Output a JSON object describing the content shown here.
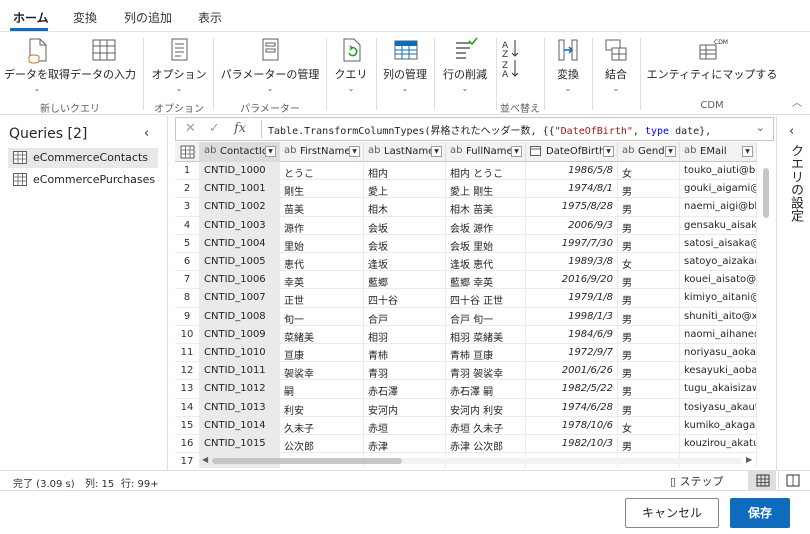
{
  "tabs": [
    {
      "label": "ホーム"
    },
    {
      "label": "変換"
    },
    {
      "label": "列の追加"
    },
    {
      "label": "表示"
    }
  ],
  "ribbon": {
    "get_data": "データを取得",
    "enter_data": "データの入力",
    "options": "オプション",
    "manage_params": "パラメーターの管理",
    "query": "クエリ",
    "manage_columns": "列の管理",
    "reduce_rows": "行の削減",
    "transform": "変換",
    "combine": "結合",
    "map_entity": "エンティティにマップする",
    "cdm_badge": "CDM",
    "groups": {
      "new_query": "新しいクエリ",
      "options": "オプション",
      "params": "パラメーター",
      "sort": "並べ替え",
      "cdm": "CDM"
    }
  },
  "queries": {
    "title": "Queries [2]",
    "items": [
      {
        "label": "eCommerceContacts"
      },
      {
        "label": "eCommercePurchases"
      }
    ]
  },
  "formula": {
    "fx": "fx",
    "part1": "Table.TransformColumnTypes(昇格されたヘッダー数, {{",
    "part2": "\"DateOfBirth\"",
    "part3": ", ",
    "part4": "type",
    "part5": " date},"
  },
  "grid": {
    "columns": [
      {
        "type": "ab",
        "name": "ContactId"
      },
      {
        "type": "ab",
        "name": "FirstName"
      },
      {
        "type": "ab",
        "name": "LastName"
      },
      {
        "type": "ab",
        "name": "FullName"
      },
      {
        "type": "date",
        "name": "DateOfBirth"
      },
      {
        "type": "ab",
        "name": "Gender"
      },
      {
        "type": "ab",
        "name": "EMail"
      }
    ],
    "rows": [
      {
        "n": "1",
        "c": [
          "CNTID_1000",
          "とうこ",
          "相内",
          "相内 とうこ",
          "1986/5/8",
          "女",
          "touko_aiuti@bb"
        ]
      },
      {
        "n": "2",
        "c": [
          "CNTID_1001",
          "剛生",
          "愛上",
          "愛上 剛生",
          "1974/8/1",
          "男",
          "gouki_aigami@"
        ]
      },
      {
        "n": "3",
        "c": [
          "CNTID_1002",
          "苗美",
          "相木",
          "相木 苗美",
          "1975/8/28",
          "男",
          "naemi_aigi@bb"
        ]
      },
      {
        "n": "4",
        "c": [
          "CNTID_1003",
          "源作",
          "会坂",
          "会坂 源作",
          "2006/9/3",
          "男",
          "gensaku_aisaka"
        ]
      },
      {
        "n": "5",
        "c": [
          "CNTID_1004",
          "里始",
          "会坂",
          "会坂 里始",
          "1997/7/30",
          "男",
          "satosi_aisaka@"
        ]
      },
      {
        "n": "6",
        "c": [
          "CNTID_1005",
          "恵代",
          "逢坂",
          "逢坂 恵代",
          "1989/3/8",
          "女",
          "satoyo_aizaka@"
        ]
      },
      {
        "n": "7",
        "c": [
          "CNTID_1006",
          "幸英",
          "藍郷",
          "藍郷 幸英",
          "2016/9/20",
          "男",
          "kouei_aisato@"
        ]
      },
      {
        "n": "8",
        "c": [
          "CNTID_1007",
          "正世",
          "四十谷",
          "四十谷 正世",
          "1979/1/8",
          "男",
          "kimiyo_aitani@"
        ]
      },
      {
        "n": "9",
        "c": [
          "CNTID_1008",
          "旬一",
          "合戸",
          "合戸 旬一",
          "1998/1/3",
          "男",
          "shuniti_aito@xy"
        ]
      },
      {
        "n": "10",
        "c": [
          "CNTID_1009",
          "菜緒美",
          "相羽",
          "相羽 菜緒美",
          "1984/6/9",
          "男",
          "naomi_aihane@"
        ]
      },
      {
        "n": "11",
        "c": [
          "CNTID_1010",
          "亘康",
          "青柿",
          "青柿 亘康",
          "1972/9/7",
          "男",
          "noriyasu_aokak"
        ]
      },
      {
        "n": "12",
        "c": [
          "CNTID_1011",
          "袈裟幸",
          "青羽",
          "青羽 袈裟幸",
          "2001/6/26",
          "男",
          "kesayuki_aoba@"
        ]
      },
      {
        "n": "13",
        "c": [
          "CNTID_1012",
          "嗣",
          "赤石澤",
          "赤石澤 嗣",
          "1982/5/22",
          "男",
          "tugu_akaisizawa"
        ]
      },
      {
        "n": "14",
        "c": [
          "CNTID_1013",
          "利安",
          "安河内",
          "安河内 利安",
          "1974/6/28",
          "男",
          "tosiyasu_akauti"
        ]
      },
      {
        "n": "15",
        "c": [
          "CNTID_1014",
          "久未子",
          "赤垣",
          "赤垣 久未子",
          "1978/10/6",
          "女",
          "kumiko_akagak"
        ]
      },
      {
        "n": "16",
        "c": [
          "CNTID_1015",
          "公次郎",
          "赤津",
          "赤津 公次郎",
          "1982/10/3",
          "男",
          "kouzirou_akatu"
        ]
      },
      {
        "n": "17",
        "c": [
          "",
          "",
          "",
          "",
          "",
          "",
          ""
        ]
      }
    ]
  },
  "right_pane": {
    "title": "クエリの設定"
  },
  "status": {
    "state": "完了 (3.09 s)",
    "columns": "列: 15",
    "rows": "行: 99+",
    "steps": "ステップ"
  },
  "footer": {
    "cancel": "キャンセル",
    "save": "保存"
  },
  "colors": {
    "accent": "#0f6cbd",
    "green_icon": "#13a10e"
  }
}
